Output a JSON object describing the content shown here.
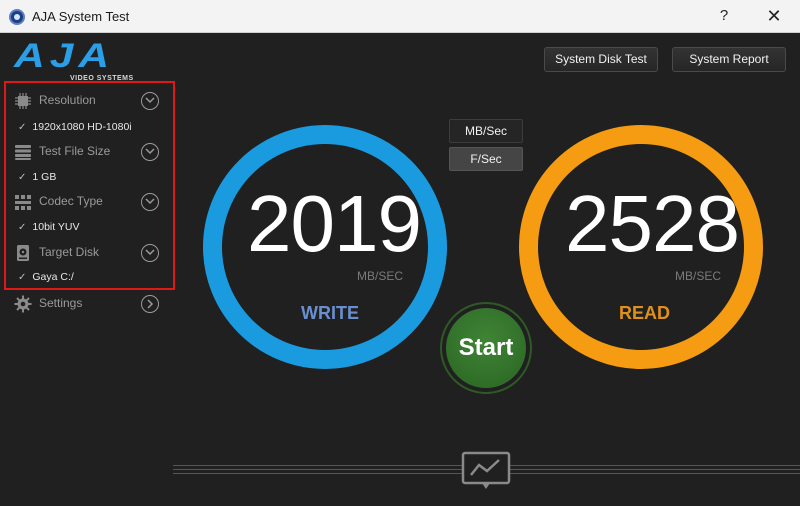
{
  "window": {
    "title": "AJA System Test",
    "help_label": "?",
    "close_label": "✕"
  },
  "logo": {
    "text": "AJA",
    "subtitle": "VIDEO SYSTEMS"
  },
  "top_buttons": {
    "system_disk_test": "System Disk Test",
    "system_report": "System Report"
  },
  "sidebar": {
    "resolution": {
      "label": "Resolution",
      "value": "1920x1080 HD-1080i"
    },
    "test_file_size": {
      "label": "Test File Size",
      "value": "1 GB"
    },
    "codec_type": {
      "label": "Codec Type",
      "value": "10bit YUV"
    },
    "target_disk": {
      "label": "Target Disk",
      "value": "Gaya C:/"
    },
    "settings": {
      "label": "Settings"
    }
  },
  "units": {
    "mb_sec": "MB/Sec",
    "f_sec": "F/Sec",
    "selected": "F/Sec"
  },
  "write": {
    "value": "2019",
    "unit": "MB/SEC",
    "label": "WRITE",
    "color": "#1a9be0"
  },
  "read": {
    "value": "2528",
    "unit": "MB/SEC",
    "label": "READ",
    "color": "#f59c12"
  },
  "start": {
    "label": "Start"
  },
  "colors": {
    "background": "#202020",
    "highlight_box": "#e01818",
    "write_label": "#6a8fd0",
    "read_label": "#e0901c",
    "start_button": "#3a7a31"
  },
  "icons": {
    "resolution": "chip-icon",
    "test_file_size": "stack-icon",
    "codec_type": "grid-icon",
    "target_disk": "disk-icon",
    "settings": "gear-icon",
    "graph": "graph-icon"
  }
}
